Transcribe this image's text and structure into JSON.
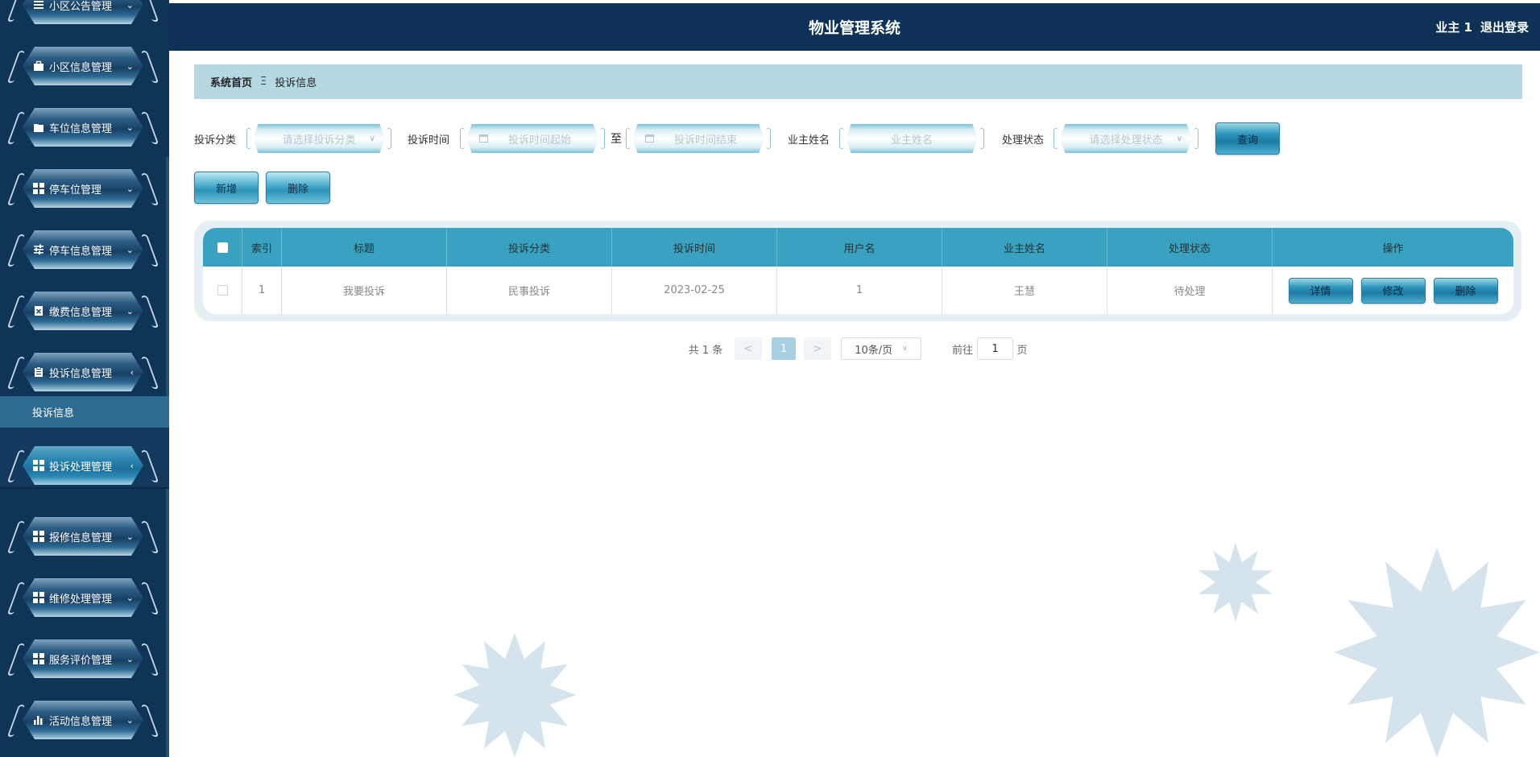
{
  "colors": {
    "sidebar_bg": "#0f3556",
    "header_bg": "#0d3255",
    "accent": "#3aa2c1",
    "breadcrumb_bg": "#b4d9e2"
  },
  "header": {
    "title": "物业管理系统",
    "user": "业主 1",
    "logout": "退出登录"
  },
  "sidebar": {
    "items": [
      {
        "label": "小区公告管理",
        "icon": "list-icon",
        "chevron": "⌄"
      },
      {
        "label": "小区信息管理",
        "icon": "briefcase-icon",
        "chevron": "⌄"
      },
      {
        "label": "车位信息管理",
        "icon": "folder-icon",
        "chevron": "⌄"
      },
      {
        "label": "停车位管理",
        "icon": "grid-icon",
        "chevron": "⌄"
      },
      {
        "label": "停车信息管理",
        "icon": "sliders-icon",
        "chevron": "⌄"
      },
      {
        "label": "缴费信息管理",
        "icon": "doc-x-icon",
        "chevron": "⌄"
      },
      {
        "label": "投诉信息管理",
        "icon": "clipboard-icon",
        "chevron": "‹"
      },
      {
        "label": "投诉处理管理",
        "icon": "grid-icon",
        "chevron": "‹"
      },
      {
        "label": "报修信息管理",
        "icon": "grid-icon",
        "chevron": "⌄"
      },
      {
        "label": "维修处理管理",
        "icon": "grid-icon",
        "chevron": "⌄"
      },
      {
        "label": "服务评价管理",
        "icon": "grid-icon",
        "chevron": "⌄"
      },
      {
        "label": "活动信息管理",
        "icon": "bar-chart-icon",
        "chevron": "⌄"
      }
    ],
    "submenu": {
      "label": "投诉信息"
    }
  },
  "breadcrumb": {
    "home": "系统首页",
    "separator": "Ξ",
    "current": "投诉信息"
  },
  "search": {
    "category_label": "投诉分类",
    "category_placeholder": "请选择投诉分类",
    "time_label": "投诉时间",
    "time_start_placeholder": "投诉时间起始",
    "to": "至",
    "time_end_placeholder": "投诉时间结束",
    "owner_label": "业主姓名",
    "owner_placeholder": "业主姓名",
    "status_label": "处理状态",
    "status_placeholder": "请选择处理状态",
    "query_button": "查询"
  },
  "actions": {
    "add": "新增",
    "delete": "删除"
  },
  "table": {
    "columns": [
      "索引",
      "标题",
      "投诉分类",
      "投诉时间",
      "用户名",
      "业主姓名",
      "处理状态",
      "操作"
    ],
    "rows": [
      {
        "index": "1",
        "title": "我要投诉",
        "category": "民事投诉",
        "time": "2023-02-25",
        "username": "1",
        "owner": "王慧",
        "status": "待处理"
      }
    ],
    "row_actions": {
      "detail": "详情",
      "edit": "修改",
      "delete": "删除"
    }
  },
  "pagination": {
    "total": "共 1 条",
    "prev": "<",
    "current": "1",
    "next": ">",
    "page_size": "10条/页",
    "goto_label": "前往",
    "goto_value": "1",
    "page_suffix": "页"
  }
}
